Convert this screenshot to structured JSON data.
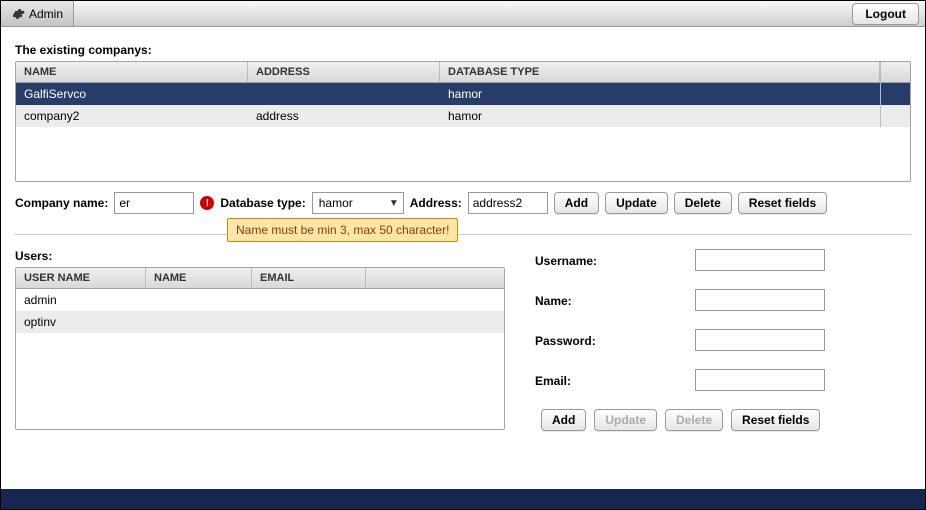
{
  "topbar": {
    "admin_label": "Admin",
    "logout_label": "Logout"
  },
  "companies": {
    "title": "The existing companys:",
    "columns": {
      "name": "NAME",
      "address": "ADDRESS",
      "db": "DATABASE TYPE"
    },
    "rows": [
      {
        "name": "GalfiServco",
        "address": "",
        "db": "hamor",
        "selected": true
      },
      {
        "name": "company2",
        "address": "address",
        "db": "hamor",
        "selected": false
      }
    ]
  },
  "company_form": {
    "name_label": "Company name:",
    "name_value": "er",
    "db_label": "Database type:",
    "db_value": "hamor",
    "addr_label": "Address:",
    "addr_value": "address2",
    "add": "Add",
    "update": "Update",
    "delete": "Delete",
    "reset": "Reset fields",
    "error_tooltip": "Name must be min 3, max 50 character!"
  },
  "users": {
    "title": "Users:",
    "columns": {
      "username": "USER NAME",
      "name": "NAME",
      "email": "EMAIL"
    },
    "rows": [
      {
        "username": "admin",
        "name": "",
        "email": ""
      },
      {
        "username": "optinv",
        "name": "",
        "email": ""
      }
    ]
  },
  "user_form": {
    "username_label": "Username:",
    "name_label": "Name:",
    "password_label": "Password:",
    "email_label": "Email:",
    "username_value": "",
    "name_value": "",
    "password_value": "",
    "email_value": "",
    "add": "Add",
    "update": "Update",
    "delete": "Delete",
    "reset": "Reset fields"
  }
}
